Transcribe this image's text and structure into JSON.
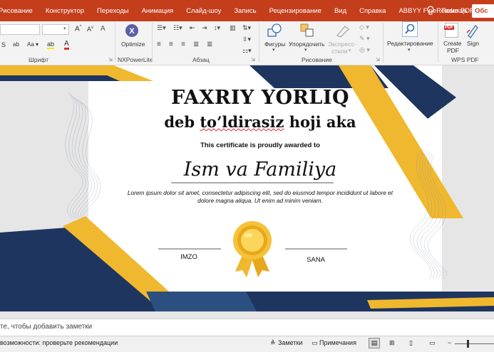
{
  "menu": {
    "tabs": [
      "Рисование",
      "Конструктор",
      "Переходы",
      "Анимация",
      "Слайд-шоу",
      "Запись",
      "Рецензирование",
      "Вид",
      "Справка",
      "ABBYY FineReader PDF"
    ],
    "help": "Помощь",
    "share": "Обс"
  },
  "ribbon": {
    "font_group": "Шрифт",
    "nxpowerlite_group": "NXPowerLite",
    "optimize": "Optimize",
    "paragraph_group": "Абзац",
    "shapes": "Фигуры",
    "arrange": "Упорядочить",
    "express_styles_1": "Экспресс-",
    "express_styles_2": "стили",
    "drawing_group": "Рисование",
    "editing": "Редактирование",
    "create_pdf_1": "Create",
    "create_pdf_2": "PDF",
    "sign": "Sign",
    "wps_group": "WPS PDF",
    "pdf_badge": "PDF"
  },
  "certificate": {
    "title": "FAXRIY YORLIQ",
    "subtitle_a": "deb ",
    "subtitle_b": "to’ldirasiz",
    "subtitle_c": " hoji aka",
    "awarded": "This certificate is proudly awarded to",
    "name": "Ism va Familiya",
    "lorem": "Lorem ipsum dolor sit amet, consectetur adipiscing elit, sed do eiusmod tempor incididunt ut labore et dolore magna aliqua. Ut enim ad minim veniam.",
    "signature": "IMZO",
    "date": "SANA"
  },
  "notes": {
    "placeholder": "те, чтобы добавить заметки"
  },
  "status": {
    "accessibility": "возможности: проверьте рекомендации",
    "notes_btn": "Заметки",
    "comments_btn": "Примечания"
  },
  "colors": {
    "ribbon_accent": "#c43e1c",
    "navy": "#1e3560",
    "gold": "#f0b82e"
  }
}
